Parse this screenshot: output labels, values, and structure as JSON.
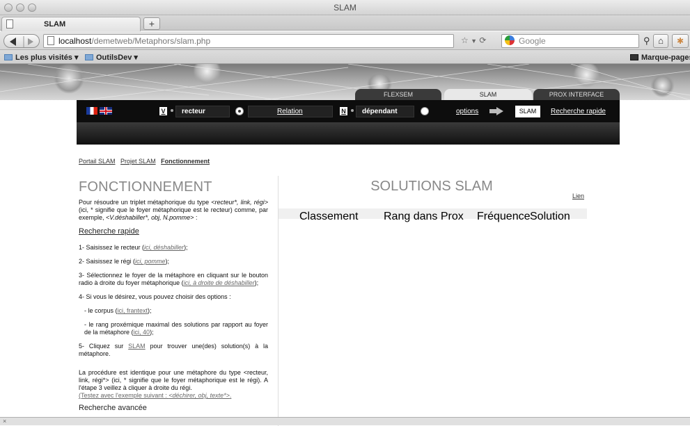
{
  "window": {
    "title": "SLAM"
  },
  "tabs": [
    {
      "label": "SLAM"
    }
  ],
  "newtab_label": "+",
  "url": {
    "host": "localhost",
    "path": "/demetweb/Metaphors/slam.php"
  },
  "search": {
    "placeholder": "Google"
  },
  "bookmarks": [
    {
      "label": "Les plus visités ▾"
    },
    {
      "label": "OutilsDev ▾"
    }
  ],
  "bookmarks_menu": "Marque-pages ▾",
  "site_tabs": [
    {
      "label": "FLEXSEM"
    },
    {
      "label": "SLAM"
    },
    {
      "label": "PROX INTERFACE"
    }
  ],
  "controls": {
    "v_label": "V",
    "v_value": "recteur",
    "relation_label": "Relation",
    "n_label": "N",
    "n_value": "dépendant",
    "options_label": "options",
    "slam_button": "SLAM",
    "quick_search": "Recherche rapide"
  },
  "breadcrumb": [
    "Portail SLAM",
    "Projet SLAM",
    "Fonctionnement"
  ],
  "left": {
    "title": "FONCTIONNEMENT",
    "intro_a": "Pour résoudre un triplet métaphorique du type ",
    "intro_em": "<recteur*, link, régi>",
    "intro_b": " (ici, * signifie que le foyer métaphorique est le recteur) comme, par exemple, ",
    "intro_em2": "<V.déshabiller*, obj, N.pomme>",
    "intro_c": " :",
    "sub1": "Recherche rapide",
    "step1": "1- Saisissez le recteur (",
    "step1_link": "ici, déshabiller",
    "step1_end": ");",
    "step2": "2- Saisissez le régi (",
    "step2_link": "ici, pomme",
    "step2_end": ");",
    "step3": "3- Sélectionnez le foyer de la métaphore en cliquant sur le bouton radio à droite du foyer métaphorique (",
    "step3_link": "ici, à droite de déshabiller",
    "step3_end": ");",
    "step4": "4- Si vous le désirez, vous pouvez choisir des options :",
    "opt1": "- le corpus (",
    "opt1_link": "ici, frantext",
    "opt1_end": ");",
    "opt2": "- le rang proxémique maximal des solutions par rapport au foyer de la métaphore (",
    "opt2_link": "ici, 40",
    "opt2_end": ");",
    "step5": "5- Cliquez sur ",
    "step5_link": "SLAM",
    "step5_end": " pour trouver une(des) solution(s) à la métaphore.",
    "para2": "La procédure est identique pour une métaphore du type <recteur, link, régi*> (ici, * signifie que le foyer métaphorique est le régi). A l'étape 3 veillez à cliquer à droite du régi.",
    "test_a": "(Testez avec l'exemple suivant : ",
    "test_em": "<déchirer, obj, texte*>",
    "test_b": ".",
    "sub2": "Recherche avancée"
  },
  "right": {
    "title": "SOLUTIONS SLAM",
    "link": "Lien",
    "columns": [
      "Classement",
      "Rang dans Prox",
      "Fréquence",
      "Solution"
    ]
  },
  "statusbar": {
    "close": "×"
  },
  "icons": {
    "back": "back-arrow-icon",
    "forward": "forward-arrow-icon",
    "star": "star-icon",
    "reload": "reload-icon",
    "home": "home-icon",
    "search": "search-icon"
  }
}
